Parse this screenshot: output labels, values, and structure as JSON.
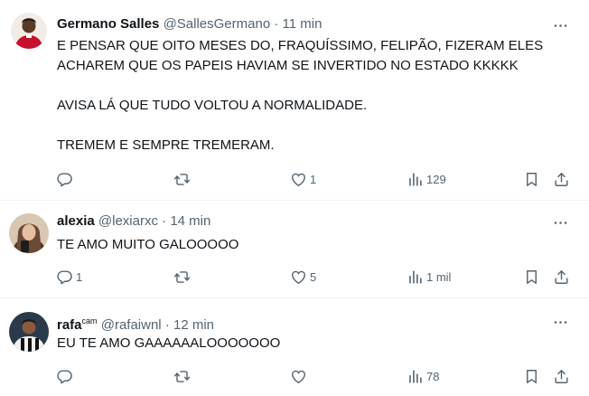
{
  "tweets": [
    {
      "name": "Germano Salles",
      "name_sup": "",
      "handle": "@SallesGermano",
      "separator": "·",
      "time": "11 min",
      "text": "E PENSAR QUE OITO MESES DO, FRAQUÍSSIMO, FELIPÃO, FIZERAM ELES ACHAREM QUE OS PAPEIS HAVIAM SE INVERTIDO NO ESTADO KKKKK\n\nAVISA LÁ QUE TUDO VOLTOU A NORMALIDADE.\n\nTREMEM E SEMPRE TREMERAM.",
      "replies": "",
      "retweets": "",
      "likes": "1",
      "views": "129"
    },
    {
      "name": "alexia",
      "name_sup": "",
      "handle": "@lexiarxc",
      "separator": "·",
      "time": "14 min",
      "text": "TE AMO MUITO GALOOOOO",
      "replies": "1",
      "retweets": "",
      "likes": "5",
      "views": "1 mil"
    },
    {
      "name": "rafa",
      "name_sup": "cam",
      "handle": "@rafaiwnl",
      "separator": "·",
      "time": "12 min",
      "text": "EU TE AMO GAAAAAALOOOOOOO",
      "replies": "",
      "retweets": "",
      "likes": "",
      "views": "78"
    }
  ],
  "icons": {
    "reply": "reply-icon",
    "retweet": "retweet-icon",
    "like": "like-icon",
    "views": "views-icon",
    "bookmark": "bookmark-icon",
    "share": "share-icon",
    "more": "more-icon"
  },
  "colors": {
    "text": "#0f1419",
    "secondary": "#536471",
    "divider": "#eff3f4",
    "background": "#ffffff"
  }
}
